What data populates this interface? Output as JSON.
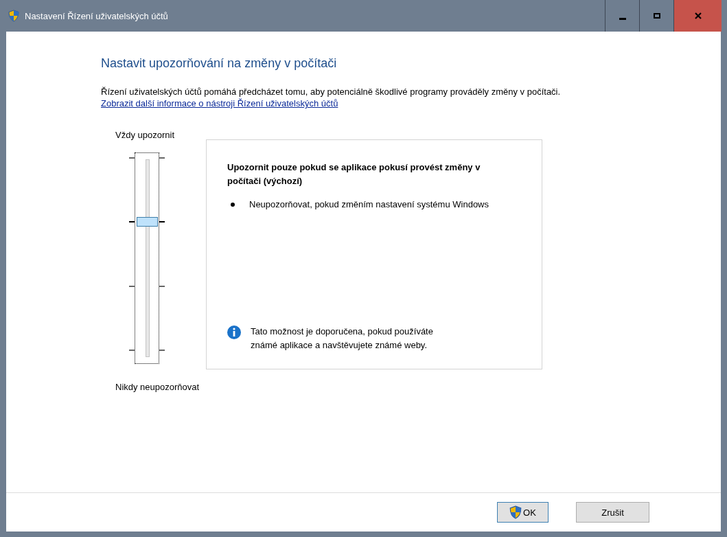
{
  "window": {
    "title": "Nastavení Řízení uživatelských účtů"
  },
  "heading": "Nastavit upozorňování na změny v počítači",
  "description": "Řízení uživatelských účtů pomáhá předcházet tomu, aby potenciálně škodlivé programy prováděly změny v počítači.",
  "info_link": "Zobrazit další informace o nástroji Řízení uživatelských účtů",
  "slider": {
    "top_label": "Vždy upozornit",
    "bottom_label": "Nikdy neupozorňovat",
    "level": 0.667
  },
  "panel": {
    "title": "Upozornit pouze pokud se aplikace pokusí provést změny v počítači (výchozí)",
    "bullets": [
      "Neupozorňovat, pokud změním nastavení systému Windows"
    ],
    "note": "Tato možnost je doporučena, pokud používáte známé aplikace a navštěvujete známé weby."
  },
  "buttons": [
    {
      "label": "OK",
      "shield": true
    },
    {
      "label": "Zrušit",
      "shield": false
    }
  ]
}
